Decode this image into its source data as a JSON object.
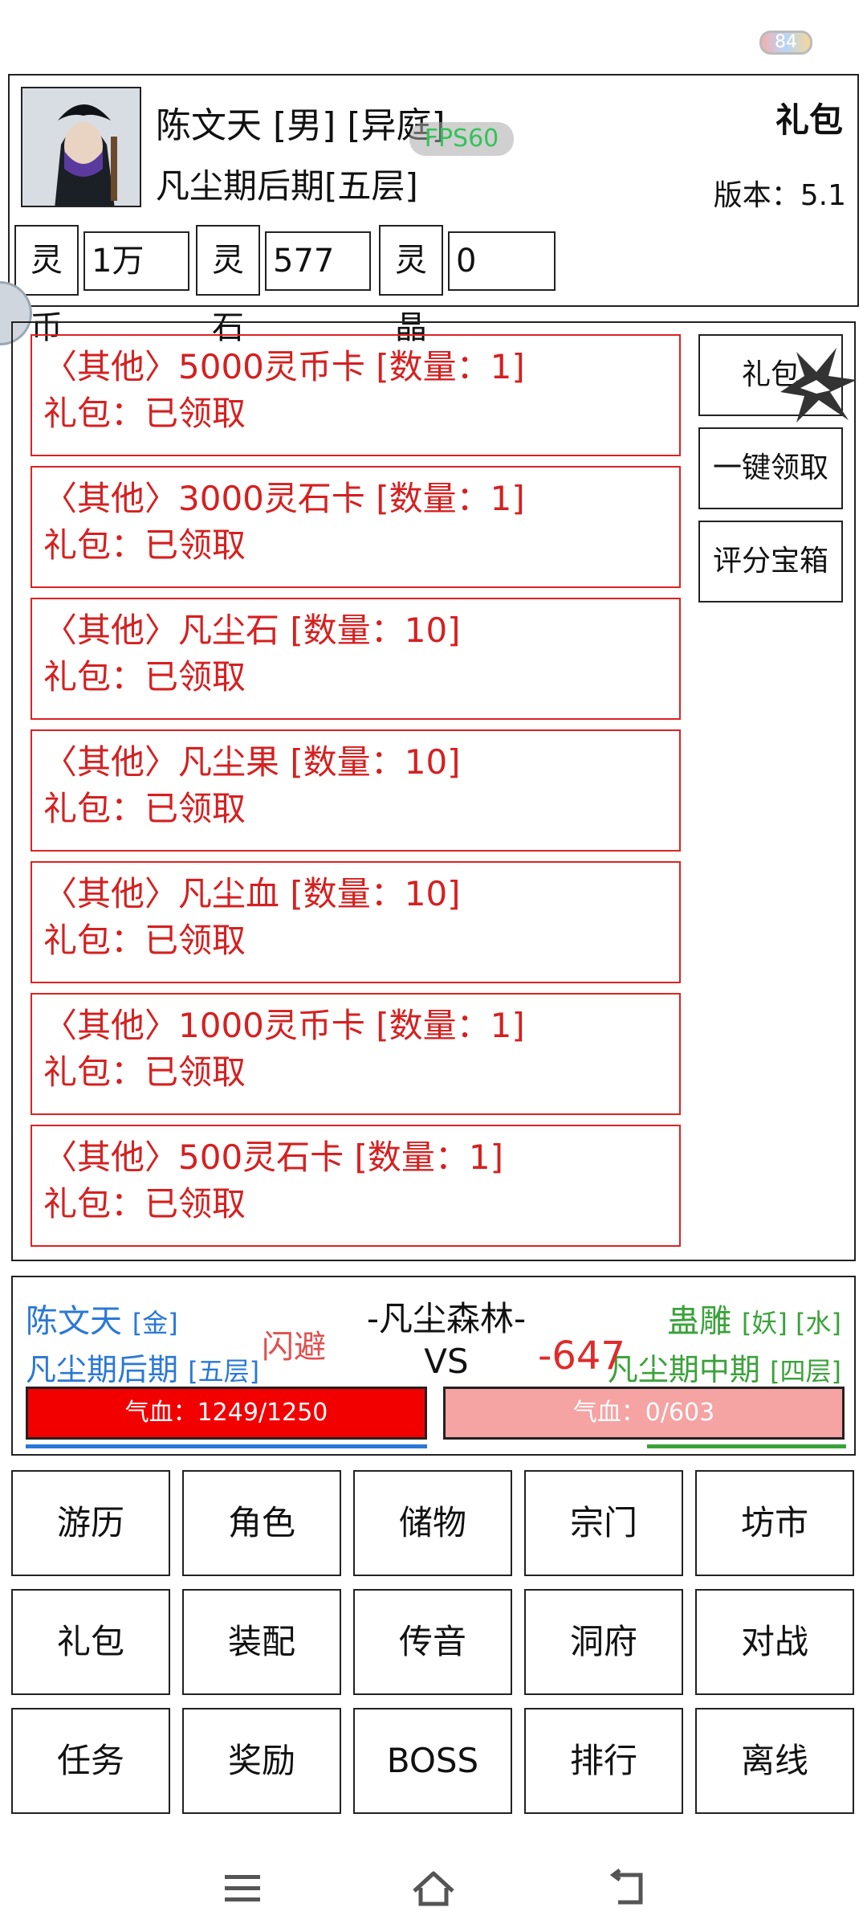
{
  "status_bar": {
    "battery": "84"
  },
  "profile": {
    "name_line": "陈文天 [男] [异庭]",
    "realm": "凡尘期后期[五层]",
    "fps": "FPS60",
    "panel_title": "礼包",
    "version": "版本：5.1"
  },
  "currencies": [
    {
      "label": "灵币",
      "value": "1万"
    },
    {
      "label": "灵石",
      "value": "577"
    },
    {
      "label": "灵晶",
      "value": "0"
    }
  ],
  "gift_items": [
    {
      "title": "〈其他〉5000灵币卡 [数量：1]",
      "status": "礼包：已领取"
    },
    {
      "title": "〈其他〉3000灵石卡 [数量：1]",
      "status": "礼包：已领取"
    },
    {
      "title": "〈其他〉凡尘石 [数量：10]",
      "status": "礼包：已领取"
    },
    {
      "title": "〈其他〉凡尘果 [数量：10]",
      "status": "礼包：已领取"
    },
    {
      "title": "〈其他〉凡尘血 [数量：10]",
      "status": "礼包：已领取"
    },
    {
      "title": "〈其他〉1000灵币卡 [数量：1]",
      "status": "礼包：已领取"
    },
    {
      "title": "〈其他〉500灵石卡 [数量：1]",
      "status": "礼包：已领取"
    }
  ],
  "side_buttons": [
    "礼包",
    "一键领取",
    "评分宝箱"
  ],
  "battle": {
    "player_name": "陈文天",
    "player_tag": "[金]",
    "player_realm": "凡尘期后期",
    "player_layer": "[五层]",
    "location": "-凡尘森林-",
    "vs": "VS",
    "dodge_text": "闪避",
    "damage_text": "-647",
    "enemy_name": "蛊雕",
    "enemy_tags": "[妖] [水]",
    "enemy_realm": "凡尘期中期",
    "enemy_layer": "[四层]",
    "player_hp": "气血：1249/1250",
    "enemy_hp": "气血：0/603",
    "player_hp_fraction": 0.999,
    "enemy_hp_fraction": 0
  },
  "menu": [
    "游历",
    "角色",
    "储物",
    "宗门",
    "坊市",
    "礼包",
    "装配",
    "传音",
    "洞府",
    "对战",
    "任务",
    "奖励",
    "BOSS",
    "排行",
    "离线"
  ],
  "colors": {
    "player": "#2a78d6",
    "enemy": "#3aa23a",
    "gift_text": "#d52020"
  }
}
